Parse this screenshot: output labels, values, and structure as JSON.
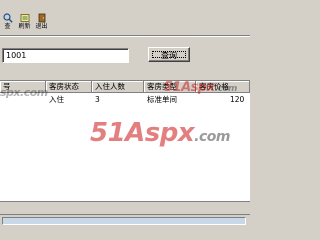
{
  "toolbar": {
    "buttons": [
      {
        "icon": "query-icon",
        "label": "查"
      },
      {
        "icon": "refresh-icon",
        "label": "刷新"
      },
      {
        "icon": "exit-icon",
        "label": "退出"
      }
    ]
  },
  "search": {
    "value": "1001",
    "button_label": "查询"
  },
  "grid": {
    "columns": [
      "号",
      "客房状态",
      "入住人数",
      "客房类型",
      "客房价格"
    ],
    "rows": [
      {
        "cells": [
          "",
          "入住",
          "3",
          "标准单间",
          "120"
        ]
      }
    ]
  },
  "watermark": {
    "brand": "51Aspx",
    "domain": ".com",
    "partial": "spx.com"
  },
  "colors": {
    "window_bg": "#d4d0c8",
    "grid_bg": "#ffffff",
    "status_panel": "#c8d8e8",
    "watermark_red": "#c80000"
  }
}
